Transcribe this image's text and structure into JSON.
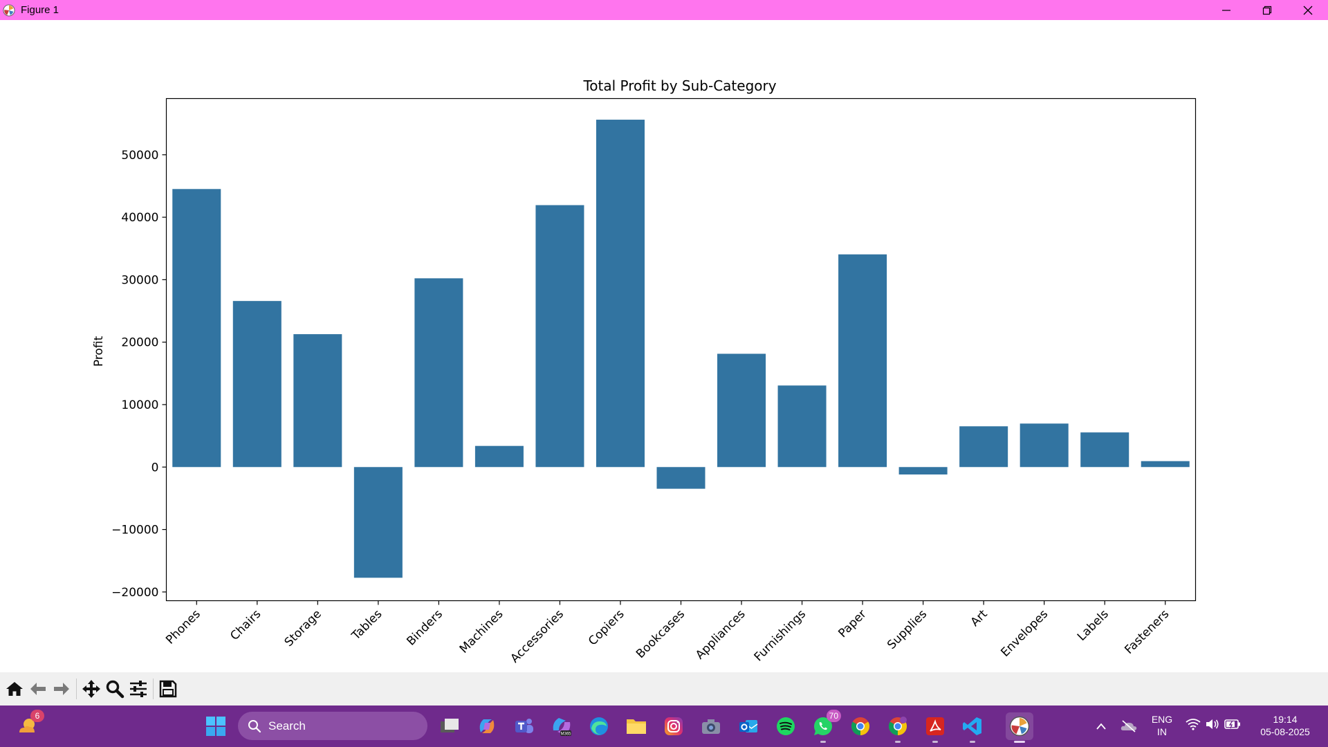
{
  "window": {
    "title": "Figure 1",
    "icon": "matplotlib-icon",
    "controls": [
      "minimize-icon",
      "restore-icon",
      "close-icon"
    ]
  },
  "chart_data": {
    "type": "bar",
    "title": "Total Profit by Sub-Category",
    "xlabel": "",
    "ylabel": "Profit",
    "categories": [
      "Phones",
      "Chairs",
      "Storage",
      "Tables",
      "Binders",
      "Machines",
      "Accessories",
      "Copiers",
      "Bookcases",
      "Appliances",
      "Furnishings",
      "Paper",
      "Supplies",
      "Art",
      "Envelopes",
      "Labels",
      "Fasteners"
    ],
    "values": [
      44516,
      26590,
      21279,
      -17725,
      30222,
      3385,
      41937,
      55618,
      -3473,
      18138,
      13059,
      34054,
      -1189,
      6528,
      6964,
      5546,
      950
    ],
    "ylim": [
      -21400,
      59000
    ],
    "yticks": [
      -20000,
      -10000,
      0,
      10000,
      20000,
      30000,
      40000,
      50000
    ],
    "ytick_labels": [
      "−20000",
      "−10000",
      "0",
      "10000",
      "20000",
      "30000",
      "40000",
      "50000"
    ],
    "bar_color": "#3274a1",
    "grid": false,
    "legend": "none"
  },
  "toolbar": {
    "buttons": [
      "home-icon",
      "back-icon",
      "forward-icon",
      "pan-icon",
      "zoom-icon",
      "configure-subplots-icon",
      "save-icon"
    ]
  },
  "taskbar": {
    "weather_badge": "6",
    "search_placeholder": "Search",
    "whatsapp_badge": "70",
    "language": "ENG",
    "region": "IN",
    "time": "19:14",
    "date": "05-08-2025",
    "accent": "#6f2a8c"
  }
}
